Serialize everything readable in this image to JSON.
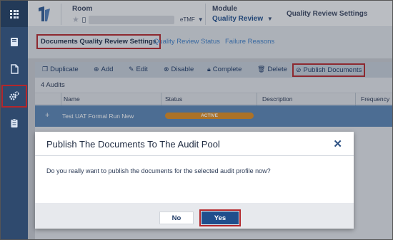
{
  "header": {
    "room_label": "Room",
    "room_suffix": "eTMF",
    "module_label": "Module",
    "module_value": "Quality Review",
    "page_crumb": "Quality Review Settings"
  },
  "tabs": [
    {
      "label": "Documents Quality Review Settings"
    },
    {
      "label": "Quality Review Status"
    },
    {
      "label": "Failure Reasons"
    }
  ],
  "toolbar": {
    "duplicate": "Duplicate",
    "add": "Add",
    "edit": "Edit",
    "disable": "Disable",
    "complete": "Complete",
    "delete": "Delete",
    "publish": "Publish Documents"
  },
  "table": {
    "count_text": "4 Audits",
    "columns": [
      "Name",
      "Status",
      "Description",
      "Frequency"
    ],
    "rows": [
      {
        "name": "Test UAT Formal Run New",
        "status": "ACTIVE"
      }
    ]
  },
  "modal": {
    "title": "Publish The Documents To The Audit Pool",
    "body": "Do you really want to publish the documents for the selected audit profile now?",
    "no_label": "No",
    "yes_label": "Yes"
  },
  "colors": {
    "rail": "#2f4a6e",
    "accent": "#1f4e8c",
    "status_active": "#e08d1f",
    "highlight_border": "#b4272b"
  }
}
